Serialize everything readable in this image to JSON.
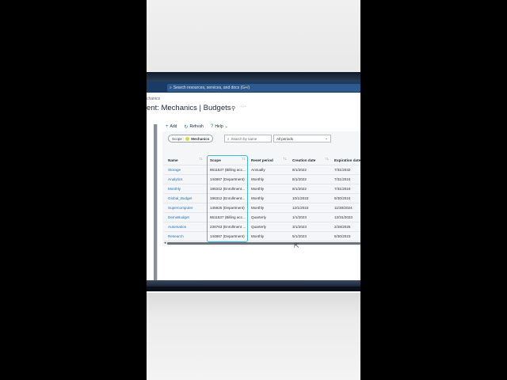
{
  "search": {
    "placeholder": "Search resources, services, and docs (G+/)"
  },
  "breadcrumb": "chanics",
  "page": {
    "title": "ent: Mechanics | Budgets"
  },
  "toolbar": {
    "add": "Add",
    "refresh": "Refresh",
    "help": "Help"
  },
  "filters": {
    "scope_label": "Scope :",
    "scope_value": "Mechanics",
    "search_placeholder": "Search by name",
    "period_value": "All periods"
  },
  "table": {
    "columns": [
      "Name",
      "Scope",
      "Reset period",
      "Creation date",
      "Expiration date"
    ],
    "rows": [
      [
        "Storage",
        "8611537 (Billing acc...",
        "Annually",
        "8/1/2022",
        "7/31/2032"
      ],
      [
        "Analytics",
        "144867 (Department)",
        "Monthly",
        "8/1/2022",
        "7/31/2024"
      ],
      [
        "Monthly",
        "196312 (Enrollment...",
        "Monthly",
        "8/1/2022",
        "7/31/2024"
      ],
      [
        "Global_Budget",
        "196312 (Enrollment...",
        "Monthly",
        "10/1/2022",
        "9/30/2024"
      ],
      [
        "Supercomputer",
        "145925 (Department)",
        "Monthly",
        "12/1/2022",
        "11/30/2024"
      ],
      [
        "DemoBudget",
        "8611537 (Billing acc...",
        "Quarterly",
        "1/1/2023",
        "12/31/2023"
      ],
      [
        "Automation",
        "236763 (Enrollment ...",
        "Quarterly",
        "3/1/2023",
        "2/28/2025"
      ],
      [
        "Research",
        "144867 (Department)",
        "Monthly",
        "5/1/2023",
        "6/30/2023"
      ]
    ]
  },
  "icons": {
    "search": "search-icon",
    "pin": "pin-icon",
    "more": "more-icon",
    "add": "plus-icon",
    "refresh": "refresh-icon",
    "help": "help-icon",
    "chevron": "chevron-down-icon"
  },
  "colors": {
    "header": "#1a3b66",
    "link": "#1f6fb8",
    "highlight": "#3fb8d8"
  }
}
